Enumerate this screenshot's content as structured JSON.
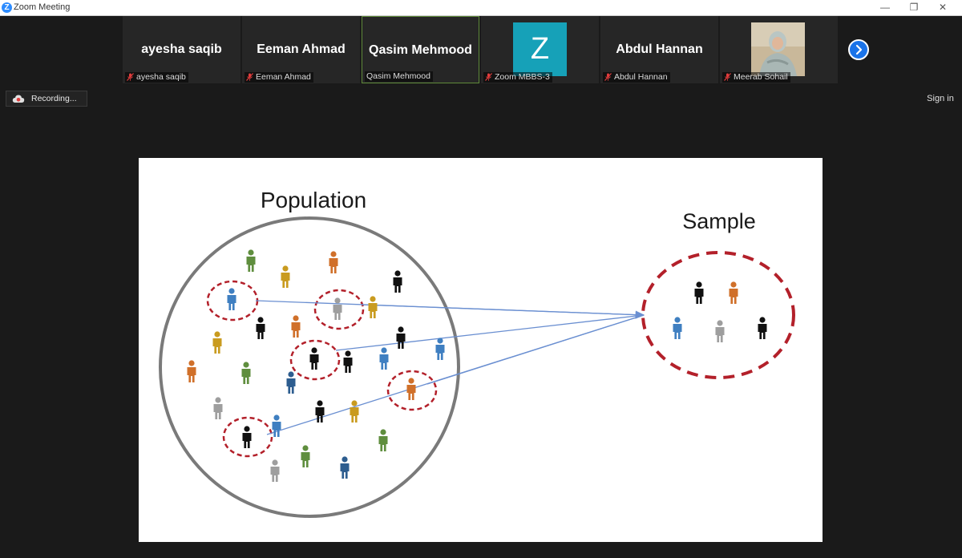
{
  "window": {
    "title": "Zoom Meeting",
    "logo_letter": "Z"
  },
  "participants": [
    {
      "display": "ayesha saqib",
      "label": "ayesha saqib"
    },
    {
      "display": "Eeman Ahmad",
      "label": "Eeman Ahmad"
    },
    {
      "display": "Qasim Mehmood",
      "label": "Qasim Mehmood"
    },
    {
      "display": "Z",
      "label": "Zoom MBBS-3"
    },
    {
      "display": "Abdul Hannan",
      "label": "Abdul Hannan"
    },
    {
      "display": "",
      "label": "Meerab Sohail"
    }
  ],
  "recording": {
    "label": "Recording..."
  },
  "signin": {
    "label": "Sign in"
  },
  "slide": {
    "population_title": "Population",
    "sample_title": "Sample"
  },
  "colors": {
    "accent": "#2d8cff",
    "avatar": "#16a1b8",
    "sample_circle": "#b3202a",
    "arrow": "#6a8fd1"
  },
  "icons": {
    "muted": "mic-muted-icon",
    "next": "chevron-right-icon",
    "recording": "cloud-recording-icon"
  }
}
